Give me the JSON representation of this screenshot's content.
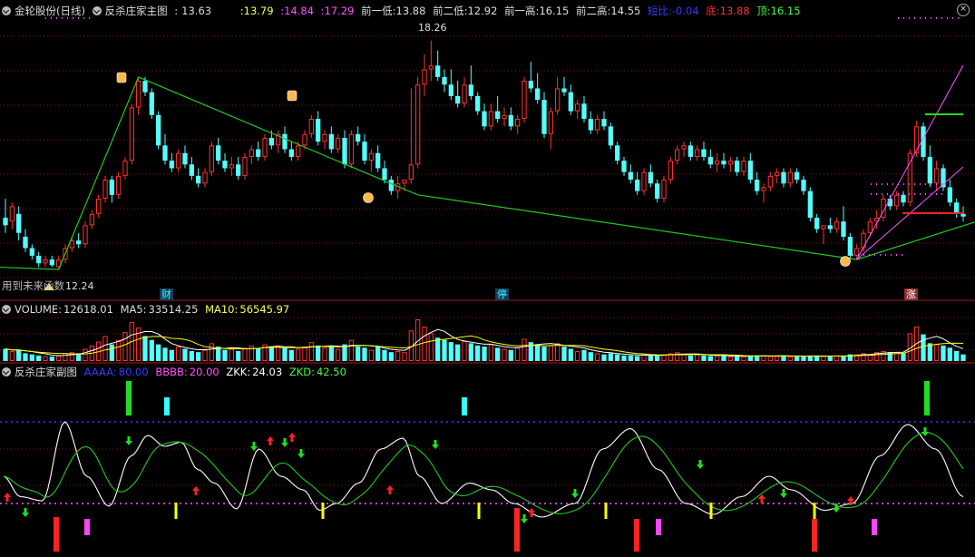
{
  "main": {
    "title": "金轮股份(日线)",
    "indicator": "反杀庄家主图",
    "close": "13.63",
    "vals": [
      ":13.79",
      ":14.84",
      ":17.29"
    ],
    "prev_low1_label": "前一低:",
    "prev_low1": "13.88",
    "prev_low2_label": "前二低:",
    "prev_low2": "12.92",
    "prev_high1_label": "前一高:",
    "prev_high1": "16.15",
    "prev_high2_label": "前二高:",
    "prev_high2": "14.55",
    "ratio_label": "短比:",
    "ratio": "-0.04",
    "bottom_label": "底:",
    "bottom": "13.88",
    "top_label": "顶:",
    "top": "16.15",
    "high_annotation": "18.26",
    "low_annotation": "12.24",
    "future_text": "用到未来函数",
    "mark_cai": "财",
    "mark_ting": "停",
    "mark_zhang": "涨"
  },
  "volume": {
    "label": "VOLUME:",
    "value": "12618.01",
    "ma5_label": "MA5:",
    "ma5": "33514.25",
    "ma10_label": "MA10:",
    "ma10": "56545.97"
  },
  "sub": {
    "title": "反杀庄家副图",
    "aaaa_label": "AAAA:",
    "aaaa": "80.00",
    "bbbb_label": "BBBB:",
    "bbbb": "20.00",
    "zkk_label": "ZKK:",
    "zkk": "24.03",
    "zkd_label": "ZKD:",
    "zkd": "42.50"
  },
  "colors": {
    "up": "#ff3232",
    "down": "#54ffff",
    "bg": "#000000",
    "grid": "#841a1a",
    "trend": "#22c922",
    "magenta": "#ff55ff",
    "white": "#ffffff",
    "yellow": "#ffff00",
    "blue": "#3a3aff",
    "green_arrow": "#00dd00",
    "cyan_text": "#33ffff"
  },
  "chart_data": [
    {
      "type": "candlestick",
      "title": "金轮股份(日线)",
      "ylim": [
        11.5,
        18.8
      ],
      "ohlc": [
        [
          13.6,
          14.1,
          13.2,
          13.4
        ],
        [
          13.5,
          14.0,
          13.3,
          13.9
        ],
        [
          13.7,
          13.9,
          13.0,
          13.2
        ],
        [
          13.1,
          13.3,
          12.7,
          12.8
        ],
        [
          12.8,
          12.9,
          12.5,
          12.6
        ],
        [
          12.6,
          12.7,
          12.3,
          12.4
        ],
        [
          12.4,
          12.6,
          12.3,
          12.5
        ],
        [
          12.5,
          12.6,
          12.3,
          12.35
        ],
        [
          12.3,
          12.6,
          12.24,
          12.5
        ],
        [
          12.5,
          12.9,
          12.4,
          12.8
        ],
        [
          12.8,
          13.1,
          12.7,
          13.0
        ],
        [
          13.0,
          13.2,
          12.8,
          12.9
        ],
        [
          12.9,
          13.5,
          12.8,
          13.4
        ],
        [
          13.4,
          13.8,
          13.3,
          13.7
        ],
        [
          13.7,
          14.2,
          13.6,
          14.1
        ],
        [
          14.1,
          14.7,
          14.0,
          14.6
        ],
        [
          14.6,
          14.7,
          14.0,
          14.2
        ],
        [
          14.2,
          14.8,
          14.1,
          14.7
        ],
        [
          14.7,
          15.2,
          14.6,
          15.1
        ],
        [
          15.1,
          16.6,
          15.0,
          16.5
        ],
        [
          16.5,
          17.3,
          16.3,
          17.2
        ],
        [
          17.2,
          17.3,
          16.8,
          16.9
        ],
        [
          16.9,
          17.0,
          16.2,
          16.3
        ],
        [
          16.3,
          16.4,
          15.4,
          15.5
        ],
        [
          15.5,
          15.8,
          15.0,
          15.1
        ],
        [
          15.1,
          15.3,
          14.8,
          14.9
        ],
        [
          14.9,
          15.4,
          14.8,
          15.3
        ],
        [
          15.3,
          15.5,
          14.9,
          15.0
        ],
        [
          15.0,
          15.2,
          14.6,
          14.7
        ],
        [
          14.7,
          14.9,
          14.4,
          14.5
        ],
        [
          14.5,
          14.9,
          14.4,
          14.8
        ],
        [
          14.8,
          15.6,
          14.7,
          15.5
        ],
        [
          15.5,
          15.7,
          15.0,
          15.1
        ],
        [
          15.1,
          15.3,
          14.8,
          14.9
        ],
        [
          14.9,
          15.2,
          14.7,
          15.0
        ],
        [
          15.0,
          15.2,
          14.6,
          14.7
        ],
        [
          14.7,
          15.3,
          14.6,
          15.2
        ],
        [
          15.2,
          15.5,
          15.0,
          15.4
        ],
        [
          15.4,
          15.6,
          15.1,
          15.2
        ],
        [
          15.2,
          15.8,
          15.1,
          15.7
        ],
        [
          15.7,
          15.9,
          15.4,
          15.5
        ],
        [
          15.5,
          15.9,
          15.3,
          15.8
        ],
        [
          15.8,
          16.0,
          15.3,
          15.4
        ],
        [
          15.4,
          15.6,
          15.1,
          15.2
        ],
        [
          15.2,
          15.6,
          15.1,
          15.5
        ],
        [
          15.5,
          15.9,
          15.4,
          15.8
        ],
        [
          15.8,
          16.3,
          15.7,
          16.2
        ],
        [
          16.2,
          16.4,
          15.5,
          15.6
        ],
        [
          15.6,
          15.9,
          15.4,
          15.8
        ],
        [
          15.8,
          16.0,
          15.3,
          15.4
        ],
        [
          15.4,
          15.8,
          15.3,
          15.7
        ],
        [
          15.7,
          15.9,
          14.9,
          15.0
        ],
        [
          15.0,
          15.9,
          14.9,
          15.8
        ],
        [
          15.8,
          16.0,
          15.5,
          15.6
        ],
        [
          15.6,
          15.8,
          15.0,
          15.1
        ],
        [
          15.1,
          15.4,
          14.8,
          15.3
        ],
        [
          15.3,
          15.5,
          14.8,
          14.9
        ],
        [
          14.9,
          15.1,
          14.5,
          14.6
        ],
        [
          14.6,
          14.7,
          14.2,
          14.3
        ],
        [
          14.3,
          14.7,
          14.1,
          14.5
        ],
        [
          14.5,
          14.6,
          14.3,
          14.6
        ],
        [
          14.6,
          17.0,
          14.5,
          15.0
        ],
        [
          15.0,
          17.3,
          14.9,
          17.1
        ],
        [
          17.1,
          17.9,
          16.8,
          17.5
        ],
        [
          17.5,
          18.26,
          17.2,
          17.6
        ],
        [
          17.6,
          18.0,
          17.2,
          17.3
        ],
        [
          17.3,
          17.5,
          16.9,
          17.1
        ],
        [
          17.1,
          17.5,
          16.7,
          16.8
        ],
        [
          16.8,
          17.2,
          16.5,
          16.6
        ],
        [
          16.6,
          17.3,
          16.5,
          17.1
        ],
        [
          17.1,
          17.6,
          16.7,
          16.8
        ],
        [
          16.8,
          16.9,
          16.3,
          16.4
        ],
        [
          16.4,
          16.6,
          15.9,
          16.0
        ],
        [
          16.0,
          16.6,
          15.9,
          16.4
        ],
        [
          16.4,
          16.8,
          16.1,
          16.2
        ],
        [
          16.2,
          16.5,
          16.0,
          16.3
        ],
        [
          16.3,
          16.5,
          15.9,
          16.0
        ],
        [
          16.0,
          16.3,
          15.8,
          16.2
        ],
        [
          16.2,
          17.3,
          16.1,
          17.2
        ],
        [
          17.2,
          17.7,
          16.9,
          17.0
        ],
        [
          17.0,
          17.4,
          16.6,
          16.7
        ],
        [
          16.7,
          16.9,
          15.7,
          15.8
        ],
        [
          15.8,
          16.5,
          15.4,
          16.4
        ],
        [
          16.4,
          17.3,
          16.3,
          17.0
        ],
        [
          17.0,
          17.3,
          16.8,
          16.9
        ],
        [
          16.9,
          17.1,
          16.3,
          16.4
        ],
        [
          16.4,
          16.7,
          16.2,
          16.6
        ],
        [
          16.6,
          16.8,
          16.1,
          16.2
        ],
        [
          16.2,
          16.4,
          15.8,
          15.9
        ],
        [
          15.9,
          16.3,
          15.8,
          16.2
        ],
        [
          16.2,
          16.4,
          15.9,
          16.0
        ],
        [
          16.0,
          16.1,
          15.4,
          15.5
        ],
        [
          15.5,
          15.6,
          15.0,
          15.1
        ],
        [
          15.1,
          15.2,
          14.7,
          14.8
        ],
        [
          14.8,
          15.0,
          14.5,
          14.6
        ],
        [
          14.6,
          14.8,
          14.2,
          14.3
        ],
        [
          14.3,
          14.9,
          14.2,
          14.8
        ],
        [
          14.8,
          15.0,
          14.4,
          14.5
        ],
        [
          14.5,
          14.6,
          14.0,
          14.1
        ],
        [
          14.1,
          14.7,
          14.0,
          14.6
        ],
        [
          14.6,
          15.2,
          14.5,
          15.1
        ],
        [
          15.1,
          15.5,
          15.0,
          15.4
        ],
        [
          15.4,
          15.6,
          15.2,
          15.5
        ],
        [
          15.5,
          15.6,
          15.1,
          15.2
        ],
        [
          15.2,
          15.5,
          15.1,
          15.4
        ],
        [
          15.4,
          15.6,
          15.1,
          15.2
        ],
        [
          15.2,
          15.4,
          14.9,
          15.0
        ],
        [
          15.0,
          15.3,
          14.8,
          15.1
        ],
        [
          15.1,
          15.3,
          14.9,
          15.0
        ],
        [
          15.0,
          15.2,
          14.8,
          15.1
        ],
        [
          15.1,
          15.2,
          14.7,
          14.8
        ],
        [
          14.8,
          15.2,
          14.7,
          15.1
        ],
        [
          15.1,
          15.3,
          14.5,
          14.6
        ],
        [
          14.6,
          14.8,
          14.2,
          14.3
        ],
        [
          14.3,
          14.5,
          14.0,
          14.4
        ],
        [
          14.4,
          14.8,
          14.3,
          14.7
        ],
        [
          14.7,
          14.9,
          14.5,
          14.8
        ],
        [
          14.8,
          14.9,
          14.4,
          14.5
        ],
        [
          14.5,
          14.9,
          14.4,
          14.8
        ],
        [
          14.8,
          14.9,
          14.5,
          14.6
        ],
        [
          14.6,
          14.7,
          14.2,
          14.3
        ],
        [
          14.3,
          14.4,
          13.5,
          13.6
        ],
        [
          13.6,
          13.7,
          13.2,
          13.3
        ],
        [
          13.3,
          13.4,
          12.9,
          13.4
        ],
        [
          13.4,
          13.6,
          13.2,
          13.3
        ],
        [
          13.3,
          13.6,
          13.2,
          13.5
        ],
        [
          13.5,
          13.9,
          13.0,
          13.1
        ],
        [
          13.1,
          13.2,
          12.5,
          12.6
        ],
        [
          12.6,
          12.9,
          12.5,
          12.8
        ],
        [
          12.8,
          13.3,
          12.7,
          13.2
        ],
        [
          13.2,
          13.6,
          13.1,
          13.5
        ],
        [
          13.5,
          13.8,
          13.3,
          13.6
        ],
        [
          13.6,
          14.2,
          13.5,
          14.1
        ],
        [
          14.1,
          14.2,
          13.8,
          13.9
        ],
        [
          13.9,
          14.3,
          13.8,
          14.2
        ],
        [
          14.2,
          14.3,
          13.9,
          14.0
        ],
        [
          14.0,
          15.4,
          13.9,
          15.3
        ],
        [
          15.3,
          16.15,
          15.2,
          16.0
        ],
        [
          16.0,
          16.1,
          15.1,
          15.2
        ],
        [
          15.2,
          15.5,
          14.4,
          14.5
        ],
        [
          14.5,
          15.1,
          14.3,
          14.9
        ],
        [
          14.9,
          15.0,
          14.3,
          14.4
        ],
        [
          14.4,
          14.6,
          13.9,
          14.0
        ],
        [
          14.0,
          14.1,
          13.6,
          13.7
        ],
        [
          13.7,
          13.9,
          13.5,
          13.63
        ]
      ]
    },
    {
      "type": "bar",
      "title": "VOLUME",
      "series": [
        {
          "name": "VOLUME",
          "values": [
            22,
            18,
            20,
            14,
            12,
            10,
            9,
            8,
            10,
            14,
            16,
            14,
            22,
            28,
            35,
            45,
            30,
            38,
            52,
            70,
            60,
            45,
            38,
            30,
            24,
            20,
            26,
            22,
            18,
            16,
            20,
            32,
            26,
            20,
            22,
            18,
            24,
            28,
            22,
            30,
            26,
            28,
            24,
            20,
            22,
            26,
            34,
            28,
            24,
            26,
            22,
            30,
            38,
            26,
            24,
            20,
            26,
            20,
            16,
            18,
            16,
            55,
            75,
            62,
            50,
            42,
            38,
            34,
            30,
            36,
            32,
            28,
            26,
            30,
            24,
            22,
            20,
            24,
            40,
            34,
            30,
            26,
            28,
            32,
            26,
            22,
            18,
            20,
            16,
            14,
            12,
            14,
            12,
            10,
            10,
            9,
            12,
            10,
            9,
            12,
            14,
            16,
            12,
            10,
            12,
            10,
            9,
            10,
            9,
            8,
            10,
            8,
            9,
            10,
            10,
            9,
            9,
            10,
            8,
            9,
            8,
            9,
            10,
            9,
            8,
            10,
            9,
            12,
            12,
            14,
            12,
            16,
            18,
            16,
            16,
            14,
            50,
            62,
            48,
            32,
            30,
            28,
            24,
            18,
            12
          ]
        },
        {
          "name": "MA5",
          "values": [
            33514
          ]
        },
        {
          "name": "MA10",
          "values": [
            56546
          ]
        }
      ]
    },
    {
      "type": "line",
      "title": "反杀庄家副图",
      "ylim": [
        -10,
        110
      ],
      "series": [
        {
          "name": "AAAA",
          "values": [
            80
          ]
        },
        {
          "name": "BBBB",
          "values": [
            20
          ]
        },
        {
          "name": "ZKK",
          "values": [
            24.03
          ]
        },
        {
          "name": "ZKD",
          "values": [
            42.5
          ]
        }
      ]
    }
  ]
}
